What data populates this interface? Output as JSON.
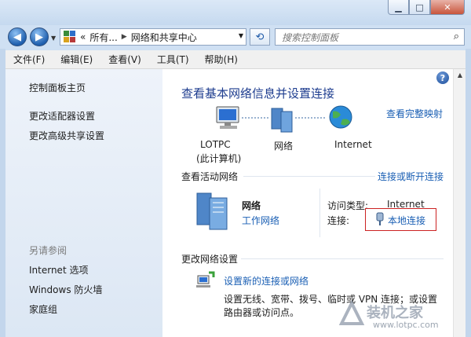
{
  "window": {
    "min_glyph": "▁",
    "max_glyph": "□",
    "close_glyph": "✕"
  },
  "address": {
    "prefix": "«",
    "crumb1": "所有...",
    "crumb2": "网络和共享中心",
    "sep": "▶"
  },
  "search": {
    "placeholder": "搜索控制面板"
  },
  "menu": [
    "文件(F)",
    "编辑(E)",
    "查看(V)",
    "工具(T)",
    "帮助(H)"
  ],
  "sidebar": {
    "home": "控制面板主页",
    "adapter": "更改适配器设置",
    "sharing": "更改高级共享设置",
    "see_also": "另请参阅",
    "internet_options": "Internet 选项",
    "firewall": "Windows 防火墙",
    "homegroup": "家庭组"
  },
  "main": {
    "title": "查看基本网络信息并设置连接",
    "full_map": "查看完整映射",
    "map": {
      "pc_name": "LOTPC",
      "pc_sub": "(此计算机)",
      "network": "网络",
      "internet": "Internet"
    },
    "active_header": "查看活动网络",
    "connect_link": "连接或断开连接",
    "active": {
      "name": "网络",
      "type": "工作网络",
      "access_label": "访问类型:",
      "access_value": "Internet",
      "conn_label": "连接:",
      "conn_value": "本地连接"
    },
    "change_header": "更改网络设置",
    "setup": {
      "link": "设置新的连接或网络",
      "desc1": "设置无线、宽带、拨号、临时或 VPN 连接；或设置",
      "desc2": "路由器或访问点。"
    }
  },
  "watermark": {
    "text": "装机之家",
    "url": "www.lotpc.com"
  },
  "colors": {
    "link": "#1a5fb4",
    "title": "#1e3d8f",
    "highlight_box": "#cc2222"
  }
}
